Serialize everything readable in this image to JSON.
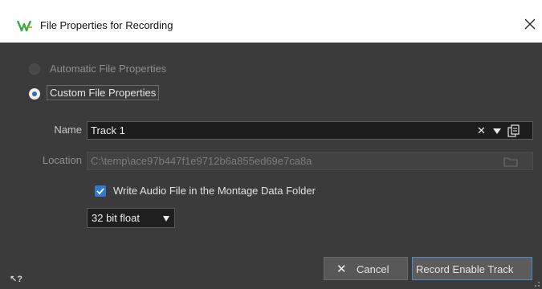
{
  "window": {
    "title": "File Properties for Recording",
    "app_icon": "wavelab-logo-icon",
    "close_icon": "close-icon"
  },
  "options": {
    "automatic_label": "Automatic File Properties",
    "automatic_selected": false,
    "custom_label": "Custom File Properties",
    "custom_selected": true
  },
  "name_field": {
    "label": "Name",
    "value": "Track 1",
    "clear_icon": "clear-x-icon",
    "dropdown_icon": "dropdown-arrow-icon",
    "copy_icon": "copy-icon"
  },
  "location_field": {
    "label": "Location",
    "value": "C:\\temp\\ace97b447f1e9712b6a855ed69e7ca8a",
    "enabled": false,
    "folder_icon": "folder-icon"
  },
  "write_audio": {
    "label": "Write Audio File in the Montage Data Folder",
    "checked": true
  },
  "format_select": {
    "value": "32 bit float"
  },
  "buttons": {
    "cancel_label": "Cancel",
    "record_label": "Record Enable Track"
  },
  "help_icon": "help-cursor-icon",
  "colors": {
    "panel_bg": "#3b3b3b",
    "accent": "#2f7bd0",
    "titlebar_bg": "#ffffff"
  }
}
